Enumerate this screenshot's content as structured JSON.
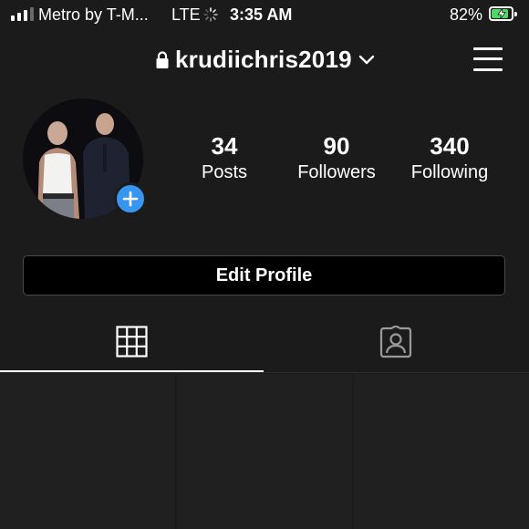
{
  "status_bar": {
    "carrier": "Metro by T-M...",
    "network": "LTE",
    "time": "3:35 AM",
    "battery_percent": "82%",
    "battery_level": 0.82,
    "signal_icon": "signal-bars-icon",
    "activity_icon": "loading-spinner-icon",
    "charging_icon": "bolt-icon"
  },
  "header": {
    "username": "krudiichris2019",
    "lock_icon": "lock-icon",
    "dropdown_icon": "chevron-down-icon",
    "menu_icon": "hamburger-menu-icon"
  },
  "profile": {
    "add_icon": "plus-icon",
    "stats": [
      {
        "value": "34",
        "label": "Posts"
      },
      {
        "value": "90",
        "label": "Followers"
      },
      {
        "value": "340",
        "label": "Following"
      }
    ],
    "edit_button_label": "Edit Profile"
  },
  "tabs": {
    "grid_icon": "grid-icon",
    "tagged_icon": "tagged-user-icon",
    "active": "grid"
  },
  "colors": {
    "background": "#1b1b1b",
    "accent_blue": "#3797f0",
    "battery_green": "#4cd964"
  }
}
